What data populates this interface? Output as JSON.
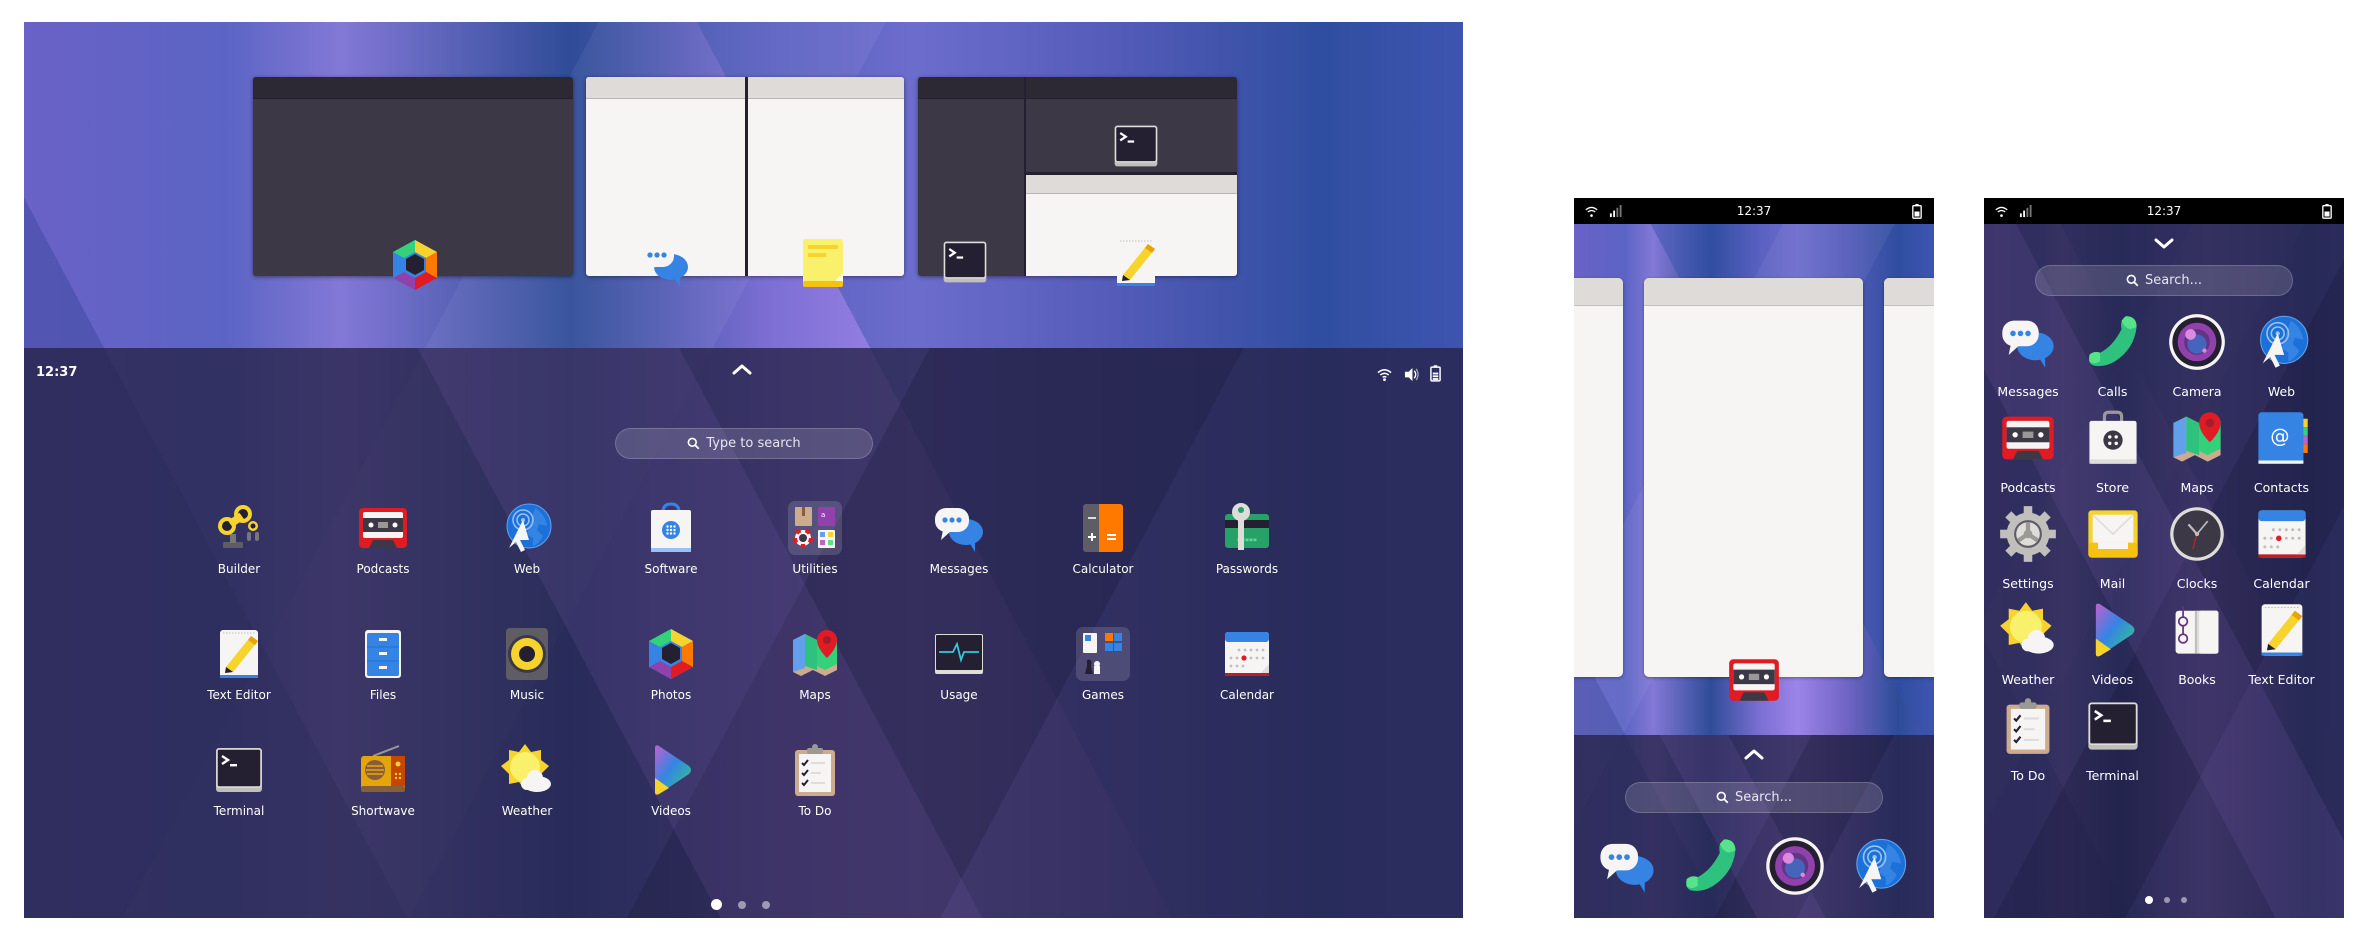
{
  "tablet": {
    "overview_windows": [
      {
        "id": "photos-window",
        "theme": "dark",
        "icon": "photos-icon",
        "app": "Photos"
      },
      {
        "id": "messages-notes-window",
        "theme": "light",
        "panes": [
          {
            "icon": "messages-icon",
            "app": "Messages"
          },
          {
            "icon": "notes-icon",
            "app": "Notes"
          }
        ]
      },
      {
        "id": "terminal-texteditor-window",
        "theme": "dark",
        "panes": [
          {
            "icon": "terminal-icon",
            "app": "Terminal"
          },
          {
            "icon": "terminal-icon",
            "app": "Terminal"
          },
          {
            "icon": "text-editor-icon",
            "app": "Text Editor"
          }
        ]
      }
    ],
    "panel": {
      "clock": "12:37",
      "expand_icon": "chevron-up-icon",
      "search_placeholder": "Type to search",
      "status_icons": [
        "wifi-icon",
        "volume-icon",
        "battery-icon"
      ]
    },
    "apps": [
      {
        "label": "Builder",
        "icon": "builder-icon"
      },
      {
        "label": "Podcasts",
        "icon": "podcasts-icon"
      },
      {
        "label": "Web",
        "icon": "web-icon"
      },
      {
        "label": "Software",
        "icon": "software-icon"
      },
      {
        "label": "Utilities",
        "icon": "folder-icon",
        "folder": true
      },
      {
        "label": "Messages",
        "icon": "messages-icon"
      },
      {
        "label": "Calculator",
        "icon": "calculator-icon"
      },
      {
        "label": "Passwords",
        "icon": "passwords-icon"
      },
      {
        "label": "Text Editor",
        "icon": "text-editor-icon"
      },
      {
        "label": "Files",
        "icon": "files-icon"
      },
      {
        "label": "Music",
        "icon": "music-icon"
      },
      {
        "label": "Photos",
        "icon": "photos-icon"
      },
      {
        "label": "Maps",
        "icon": "maps-icon"
      },
      {
        "label": "Usage",
        "icon": "usage-icon"
      },
      {
        "label": "Games",
        "icon": "folder-icon",
        "folder": true
      },
      {
        "label": "Calendar",
        "icon": "calendar-icon"
      },
      {
        "label": "Terminal",
        "icon": "terminal-icon"
      },
      {
        "label": "Shortwave",
        "icon": "shortwave-icon"
      },
      {
        "label": "Weather",
        "icon": "weather-icon"
      },
      {
        "label": "Videos",
        "icon": "videos-icon"
      },
      {
        "label": "To Do",
        "icon": "todo-icon"
      }
    ],
    "pages": {
      "count": 3,
      "current": 1
    }
  },
  "phone_overview": {
    "status": {
      "time": "12:37",
      "left_icons": [
        "wifi-icon",
        "signal-icon"
      ],
      "right_icons": [
        "battery-icon"
      ]
    },
    "active_window_app": "Podcasts",
    "expand_icon": "chevron-up-icon",
    "search_placeholder": "Search...",
    "dock": [
      {
        "app": "Messages",
        "icon": "messages-icon"
      },
      {
        "app": "Calls",
        "icon": "calls-icon"
      },
      {
        "app": "Camera",
        "icon": "camera-icon"
      },
      {
        "app": "Web",
        "icon": "web-icon"
      }
    ]
  },
  "phone_apps": {
    "status": {
      "time": "12:37",
      "left_icons": [
        "wifi-icon",
        "signal-icon"
      ],
      "right_icons": [
        "battery-icon"
      ]
    },
    "collapse_icon": "chevron-down-icon",
    "search_placeholder": "Search...",
    "apps": [
      {
        "label": "Messages",
        "icon": "messages-icon"
      },
      {
        "label": "Calls",
        "icon": "calls-icon"
      },
      {
        "label": "Camera",
        "icon": "camera-icon"
      },
      {
        "label": "Web",
        "icon": "web-icon"
      },
      {
        "label": "Podcasts",
        "icon": "podcasts-icon"
      },
      {
        "label": "Store",
        "icon": "store-icon"
      },
      {
        "label": "Maps",
        "icon": "maps-icon"
      },
      {
        "label": "Contacts",
        "icon": "contacts-icon"
      },
      {
        "label": "Settings",
        "icon": "settings-icon"
      },
      {
        "label": "Mail",
        "icon": "mail-icon"
      },
      {
        "label": "Clocks",
        "icon": "clocks-icon"
      },
      {
        "label": "Calendar",
        "icon": "calendar-icon"
      },
      {
        "label": "Weather",
        "icon": "weather-icon"
      },
      {
        "label": "Videos",
        "icon": "videos-icon"
      },
      {
        "label": "Books",
        "icon": "books-icon"
      },
      {
        "label": "Text Editor",
        "icon": "text-editor-icon"
      },
      {
        "label": "To Do",
        "icon": "todo-icon"
      },
      {
        "label": "Terminal",
        "icon": "terminal-icon"
      }
    ],
    "pages": {
      "count": 3,
      "current": 1
    }
  }
}
